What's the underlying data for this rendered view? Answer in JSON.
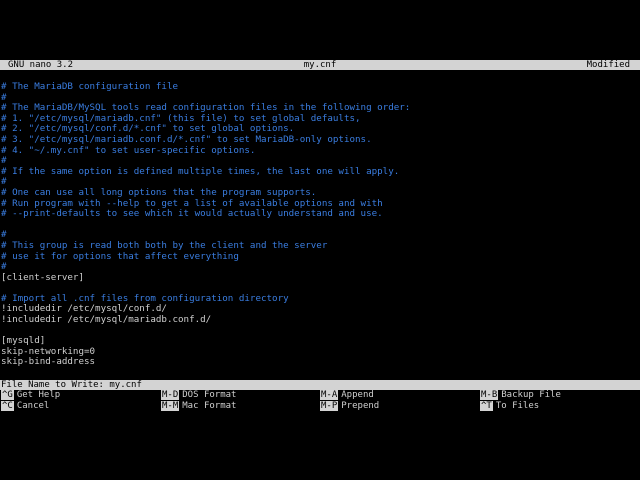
{
  "titlebar": {
    "app": "GNU nano 3.2",
    "filename": "my.cnf",
    "status": "Modified"
  },
  "buffer": {
    "lines": [
      {
        "text": "# The MariaDB configuration file",
        "kind": "comment"
      },
      {
        "text": "#",
        "kind": "comment"
      },
      {
        "text": "# The MariaDB/MySQL tools read configuration files in the following order:",
        "kind": "comment"
      },
      {
        "text": "# 1. \"/etc/mysql/mariadb.cnf\" (this file) to set global defaults,",
        "kind": "comment"
      },
      {
        "text": "# 2. \"/etc/mysql/conf.d/*.cnf\" to set global options.",
        "kind": "comment"
      },
      {
        "text": "# 3. \"/etc/mysql/mariadb.conf.d/*.cnf\" to set MariaDB-only options.",
        "kind": "comment"
      },
      {
        "text": "# 4. \"~/.my.cnf\" to set user-specific options.",
        "kind": "comment"
      },
      {
        "text": "#",
        "kind": "comment"
      },
      {
        "text": "# If the same option is defined multiple times, the last one will apply.",
        "kind": "comment"
      },
      {
        "text": "#",
        "kind": "comment"
      },
      {
        "text": "# One can use all long options that the program supports.",
        "kind": "comment"
      },
      {
        "text": "# Run program with --help to get a list of available options and with",
        "kind": "comment"
      },
      {
        "text": "# --print-defaults to see which it would actually understand and use.",
        "kind": "comment"
      },
      {
        "text": "",
        "kind": "plain"
      },
      {
        "text": "#",
        "kind": "comment"
      },
      {
        "text": "# This group is read both both by the client and the server",
        "kind": "comment"
      },
      {
        "text": "# use it for options that affect everything",
        "kind": "comment"
      },
      {
        "text": "#",
        "kind": "comment"
      },
      {
        "text": "[client-server]",
        "kind": "plain"
      },
      {
        "text": "",
        "kind": "plain"
      },
      {
        "text": "# Import all .cnf files from configuration directory",
        "kind": "comment"
      },
      {
        "text": "!includedir /etc/mysql/conf.d/",
        "kind": "plain"
      },
      {
        "text": "!includedir /etc/mysql/mariadb.conf.d/",
        "kind": "plain"
      },
      {
        "text": "",
        "kind": "plain"
      },
      {
        "text": "[mysqld]",
        "kind": "plain"
      },
      {
        "text": "skip-networking=0",
        "kind": "plain"
      },
      {
        "text": "skip-bind-address",
        "kind": "plain"
      }
    ]
  },
  "prompt": {
    "label": "File Name to Write:",
    "value": "my.cnf"
  },
  "shortcuts": [
    {
      "key": "^G",
      "label": "Get Help"
    },
    {
      "key": "M-D",
      "label": "DOS Format"
    },
    {
      "key": "M-A",
      "label": "Append"
    },
    {
      "key": "M-B",
      "label": "Backup File"
    },
    {
      "key": "^C",
      "label": "Cancel"
    },
    {
      "key": "M-M",
      "label": "Mac Format"
    },
    {
      "key": "M-P",
      "label": "Prepend"
    },
    {
      "key": "^T",
      "label": "To Files"
    }
  ],
  "colors": {
    "comment": "#3a7de0",
    "bar_bg": "#d3d3d3",
    "background": "#000000"
  }
}
